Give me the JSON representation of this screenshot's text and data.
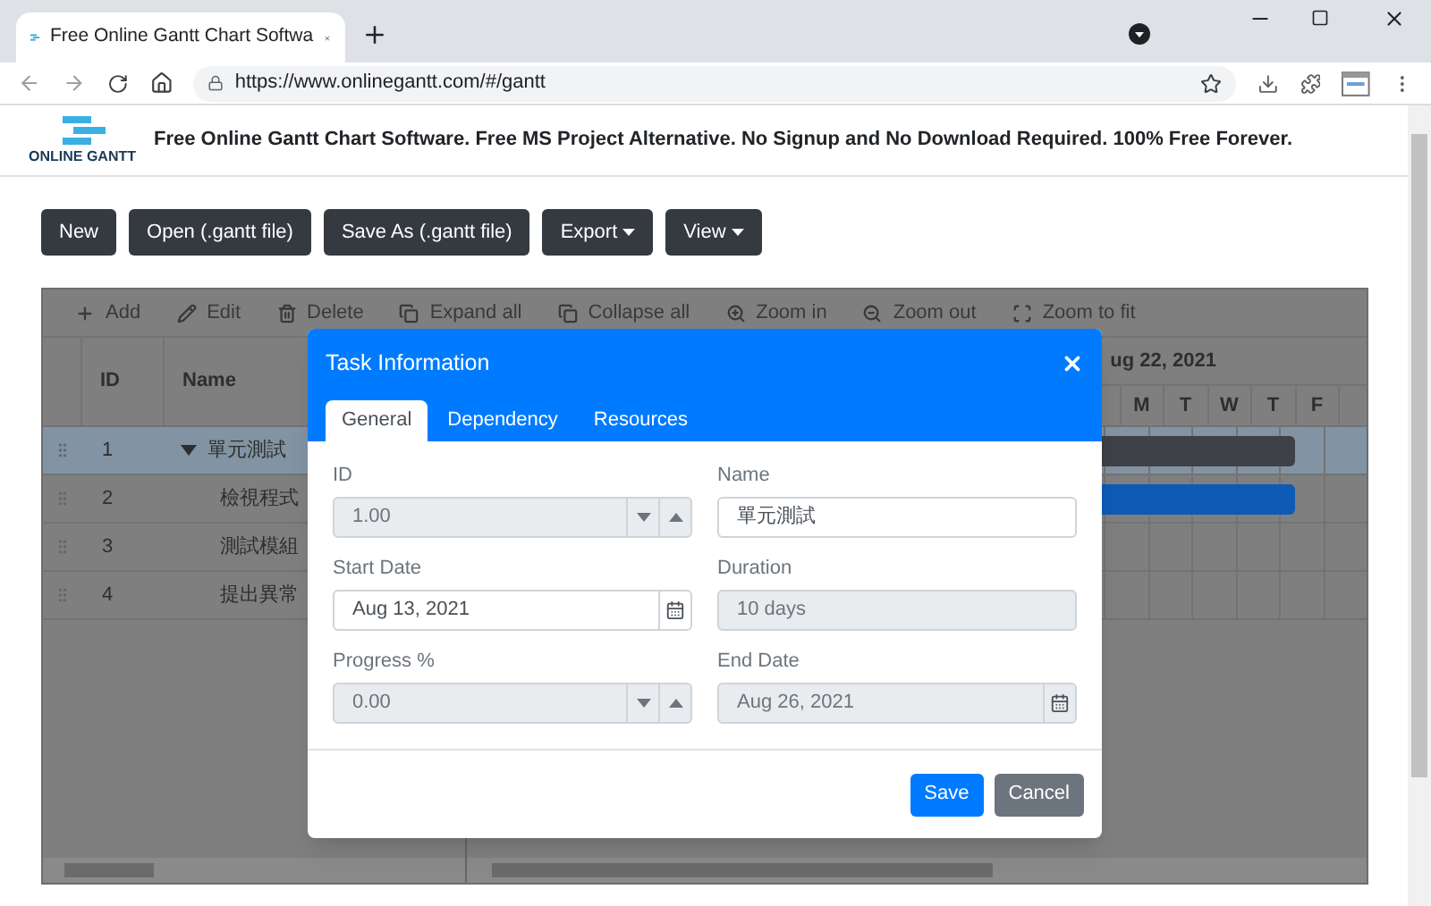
{
  "browser": {
    "tab_title": "Free Online Gantt Chart Softwa",
    "address": "https://www.onlinegantt.com/#/gantt"
  },
  "header": {
    "logo_text": "ONLINE GANTT",
    "tagline": "Free Online Gantt Chart Software. Free MS Project Alternative. No Signup and No Download Required. 100% Free Forever."
  },
  "buttons": [
    {
      "label": "New",
      "dropdown": false
    },
    {
      "label": "Open (.gantt file)",
      "dropdown": false
    },
    {
      "label": "Save As (.gantt file)",
      "dropdown": false
    },
    {
      "label": "Export",
      "dropdown": true
    },
    {
      "label": "View",
      "dropdown": true
    }
  ],
  "toolbar": [
    "Add",
    "Edit",
    "Delete",
    "Expand all",
    "Collapse all",
    "Zoom in",
    "Zoom out",
    "Zoom to fit"
  ],
  "grid": {
    "columns": [
      "ID",
      "Name"
    ],
    "rows": [
      {
        "id": "1",
        "name": "單元測試",
        "selected": true,
        "expanded": true,
        "color": "#3e4145",
        "children": [
          {
            "id": "2",
            "name": "檢視程式",
            "selected": false,
            "color": "#0d5bb5"
          },
          {
            "id": "3",
            "name": "測試模組",
            "selected": false
          },
          {
            "id": "4",
            "name": "提出異常",
            "selected": false
          }
        ]
      }
    ]
  },
  "timeline": {
    "week": "ug 22, 2021",
    "days": [
      "M",
      "T",
      "W",
      "T",
      "F"
    ]
  },
  "dialog": {
    "title": "Task Information",
    "tabs": [
      {
        "label": "General",
        "selected": true
      },
      {
        "label": "Dependency",
        "selected": false
      },
      {
        "label": "Resources",
        "selected": false
      }
    ],
    "fields": [
      {
        "label": "ID",
        "value": "1.00",
        "kind": "spinner",
        "disabled": true
      },
      {
        "label": "Name",
        "value": "單元測試",
        "kind": "text",
        "disabled": false
      },
      {
        "label": "Start Date",
        "value": "Aug 13, 2021",
        "kind": "date",
        "disabled": false
      },
      {
        "label": "Duration",
        "value": "10 days",
        "kind": "text",
        "disabled": true
      },
      {
        "label": "Progress %",
        "value": "0.00",
        "kind": "spinner",
        "disabled": true
      },
      {
        "label": "End Date",
        "value": "Aug 26, 2021",
        "kind": "date",
        "disabled": true
      }
    ],
    "buttons": [
      {
        "label": "Save",
        "kind": "primary"
      },
      {
        "label": "Cancel",
        "kind": "secondary"
      }
    ]
  }
}
